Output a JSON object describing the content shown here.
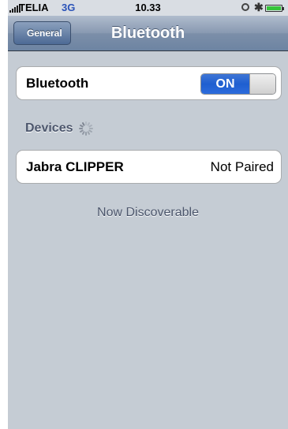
{
  "status_bar": {
    "carrier": "TELIA",
    "network": "3G",
    "time": "10.33",
    "battery_level": 1.0,
    "icons": [
      "signal-bars-icon",
      "lock-rotation-icon",
      "bluetooth-icon",
      "battery-icon"
    ]
  },
  "nav": {
    "back_label": "General",
    "title": "Bluetooth"
  },
  "bluetooth_row": {
    "label": "Bluetooth",
    "toggle_state": "ON"
  },
  "devices_section": {
    "header": "Devices"
  },
  "devices": [
    {
      "name": "Jabra CLIPPER",
      "status": "Not Paired"
    }
  ],
  "footer": "Now Discoverable",
  "colors": {
    "background": "#c5ccd4",
    "toggle_on": "#2d6cdc",
    "section_text": "#4c566c",
    "value_text": "#385487"
  }
}
